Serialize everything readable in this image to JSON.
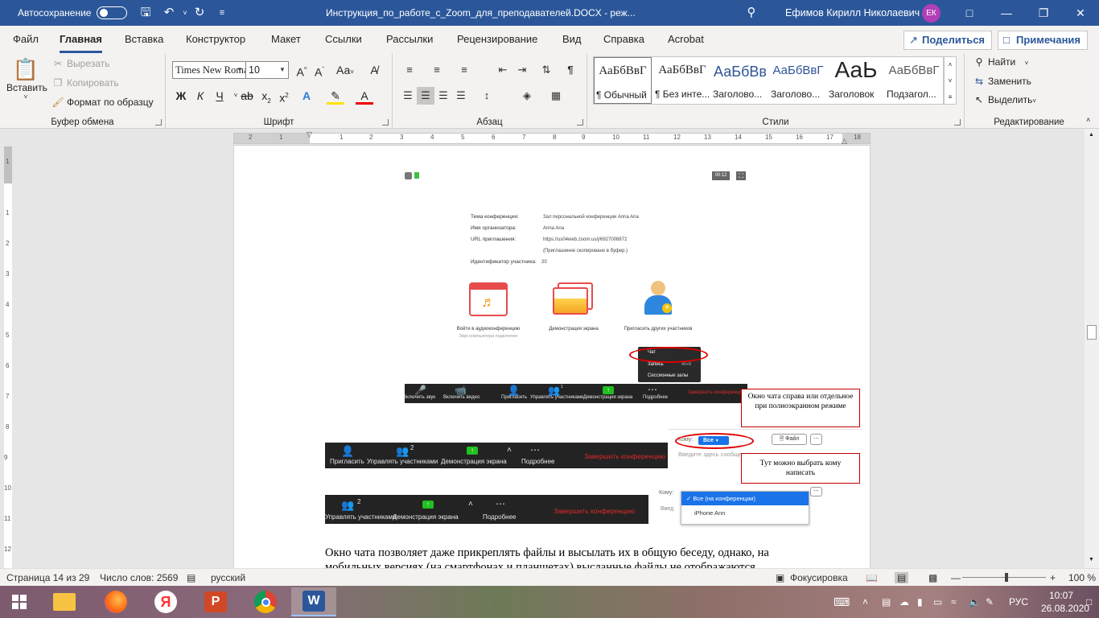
{
  "titlebar": {
    "autosave": "Автосохранение",
    "doc_title": "Инструкция_по_работе_с_Zoom_для_преподавателей.DOCX  -  реж...",
    "user": "Ефимов Кирилл Николаевич",
    "initials": "ЕК"
  },
  "tabs": [
    "Файл",
    "Главная",
    "Вставка",
    "Конструктор",
    "Макет",
    "Ссылки",
    "Рассылки",
    "Рецензирование",
    "Вид",
    "Справка",
    "Acrobat"
  ],
  "share_label": "Поделиться",
  "comments_label": "Примечания",
  "clipboard": {
    "paste": "Вставить",
    "cut": "Вырезать",
    "copy": "Копировать",
    "format_painter": "Формат по образцу",
    "label": "Буфер обмена"
  },
  "font": {
    "name": "Times New Roman",
    "size": "10",
    "label": "Шрифт",
    "case_btn": "Аа"
  },
  "paragraph_label": "Абзац",
  "styles": {
    "label": "Стили",
    "items": [
      {
        "sample": "АаБбВвГ",
        "name": "¶ Обычный"
      },
      {
        "sample": "АаБбВвГ",
        "name": "¶ Без инте..."
      },
      {
        "sample": "АаБбВв",
        "name": "Заголово..."
      },
      {
        "sample": "АаБбВвГ",
        "name": "Заголово..."
      },
      {
        "sample": "АаЬ",
        "name": "Заголовок"
      },
      {
        "sample": "АаБбВвГ",
        "name": "Подзагол..."
      }
    ]
  },
  "editing": {
    "find": "Найти",
    "replace": "Заменить",
    "select": "Выделить",
    "label": "Редактирование"
  },
  "ruler_numbers": [
    "2",
    "1",
    "1",
    "2",
    "3",
    "4",
    "5",
    "6",
    "7",
    "8",
    "9",
    "10",
    "11",
    "12",
    "13",
    "14",
    "15",
    "16",
    "17",
    "18"
  ],
  "vruler_numbers": [
    "1",
    "1",
    "2",
    "3",
    "4",
    "5",
    "6",
    "7",
    "8",
    "9",
    "10",
    "11",
    "12"
  ],
  "zoom_info": {
    "time": "00:12",
    "rows": [
      {
        "k": "Тема конференции:",
        "v": "Зал персональной конференции Anna Ana"
      },
      {
        "k": "Имя организатора:",
        "v": "Anna Ana"
      },
      {
        "k": "URL приглашения:",
        "v": "https://us04web.zoom.us/j/6927008872"
      },
      {
        "k": "",
        "v": "(Приглашение скопировано в буфер.)"
      },
      {
        "k": "Идентификатор участника:",
        "v": "20"
      }
    ],
    "actions": [
      {
        "label": "Войти в аудиоконференцию",
        "sub": "Звук компьютера подключен"
      },
      {
        "label": "Демонстрация экрана",
        "sub": ""
      },
      {
        "label": "Пригласить других участников",
        "sub": ""
      }
    ],
    "menu": [
      "Чат",
      "Запись",
      "Сессионные залы"
    ],
    "menu_hint": "Alt+R"
  },
  "bar1": {
    "items": [
      "Включить звук",
      "Включить видео",
      "Пригласить",
      "Управлять участниками",
      "Демонстрация экрана",
      "Подробнее"
    ],
    "count": "1",
    "end": "Завершить конференцию"
  },
  "bar2": {
    "items": [
      "Пригласить",
      "Управлять участниками",
      "Демонстрация экрана",
      "Подробнее"
    ],
    "count": "2",
    "end": "Завершить конференцию"
  },
  "bar3": {
    "items": [
      "Управлять участниками",
      "Демонстрация экрана",
      "Подробнее"
    ],
    "count": "2",
    "end": "Завершить конференцию"
  },
  "chat": {
    "to": "Кому:",
    "all": "Все",
    "file": "Файл",
    "placeholder": "Введите здесь сообщение...",
    "to2": "Кому:",
    "placeholder2": "Введ",
    "dropdown": [
      "Все (на конференции)",
      "iPhone Ann"
    ]
  },
  "callouts": {
    "c1": "Окно чата справа или отдельное при полноэкранном режиме",
    "c2": "Тут можно выбрать кому написать"
  },
  "doc_text": {
    "line1": "Окно чата позволяет даже прикреплять файлы и высылать их в общую беседу, однако, на",
    "line2": "мобильных версиях (на смартфонах и планшетах) высланные файлы не отображаются."
  },
  "status": {
    "page": "Страница 14 из 29",
    "words": "Число слов: 2569",
    "lang": "русский",
    "focus": "Фокусировка",
    "zoom": "100 %"
  },
  "taskbar": {
    "lang": "РУС",
    "time": "10:07",
    "date": "26.08.2020"
  }
}
